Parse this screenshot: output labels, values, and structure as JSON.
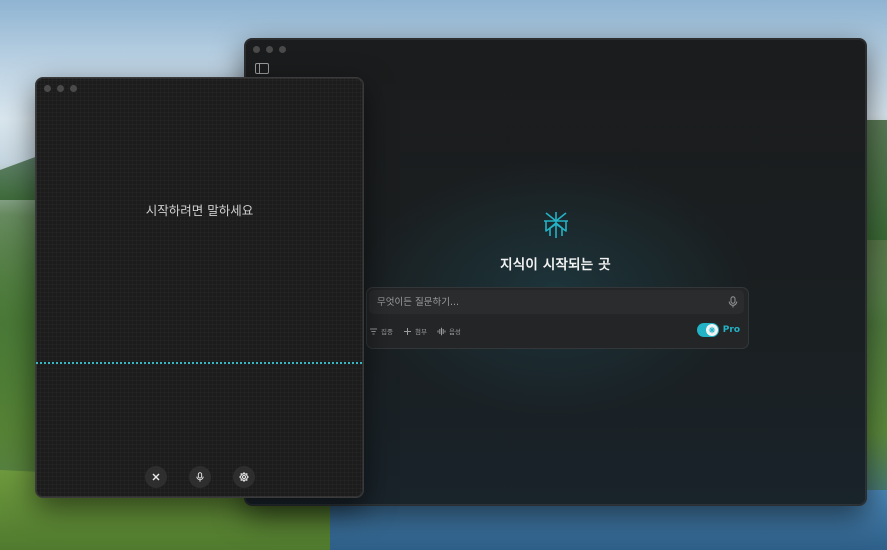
{
  "main_window": {
    "hero_title": "지식이 시작되는 곳",
    "search": {
      "placeholder": "무엇이든 질문하기..."
    },
    "tools": [
      {
        "label": "집중",
        "icon": "filter-icon"
      },
      {
        "label": "첨부",
        "icon": "plus-icon"
      },
      {
        "label": "음성",
        "icon": "waveform-icon"
      }
    ],
    "pro_label": "Pro",
    "pro_enabled": true,
    "accent_color": "#22b3c6"
  },
  "voice_window": {
    "prompt": "시작하려면 말하세요",
    "controls": [
      "close-icon",
      "mic-icon",
      "settings-icon"
    ]
  }
}
